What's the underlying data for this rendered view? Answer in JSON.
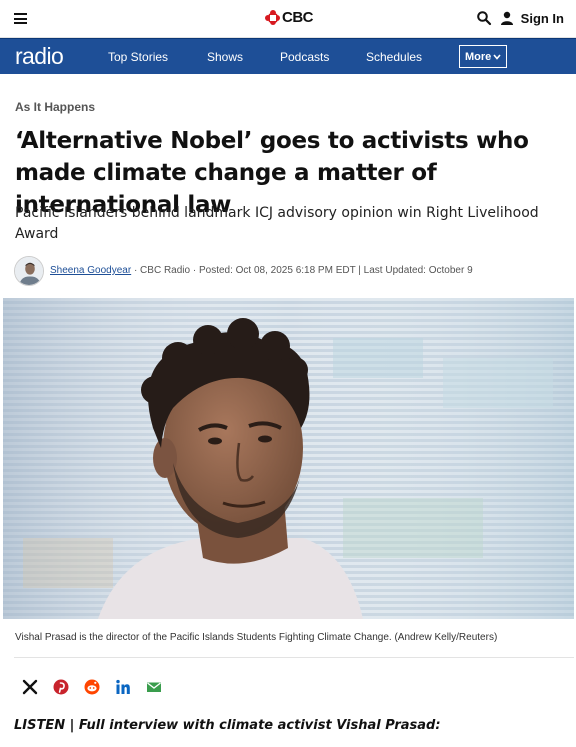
{
  "header": {
    "logo_text": "CBC",
    "sign_in": "Sign In",
    "icons": [
      "hamburger-menu-icon",
      "cbc-gem-icon",
      "search-icon",
      "user-icon"
    ]
  },
  "nav": {
    "brand": "radio",
    "items": [
      "Top Stories",
      "Shows",
      "Podcasts",
      "Schedules"
    ],
    "more": "More"
  },
  "article": {
    "kicker": "As It Happens",
    "headline": "‘Alternative Nobel’ goes to activists who made climate change a matter of international law",
    "deck": "Pacific Islanders behind landmark ICJ advisory opinion win Right Livelihood Award",
    "author": "Sheena Goodyear",
    "byline_rest": " · CBC Radio · Posted: Oct 08, 2025 6:18 PM EDT | Last Updated: October 9",
    "caption": "Vishal Prasad is the director of the Pacific Islands Students Fighting Climate Change. (Andrew Kelly/Reuters)",
    "listen": "LISTEN | Full interview with climate activist Vishal Prasad:"
  },
  "share_icons": [
    "x-icon",
    "pinterest-icon",
    "reddit-icon",
    "linkedin-icon",
    "email-icon"
  ],
  "colors": {
    "nav_blue": "#1e4f97",
    "cbc_red": "#d71920",
    "pinterest": "#c8232c",
    "reddit": "#ff4500",
    "linkedin": "#0a66c2",
    "email": "#3a9d4d"
  }
}
